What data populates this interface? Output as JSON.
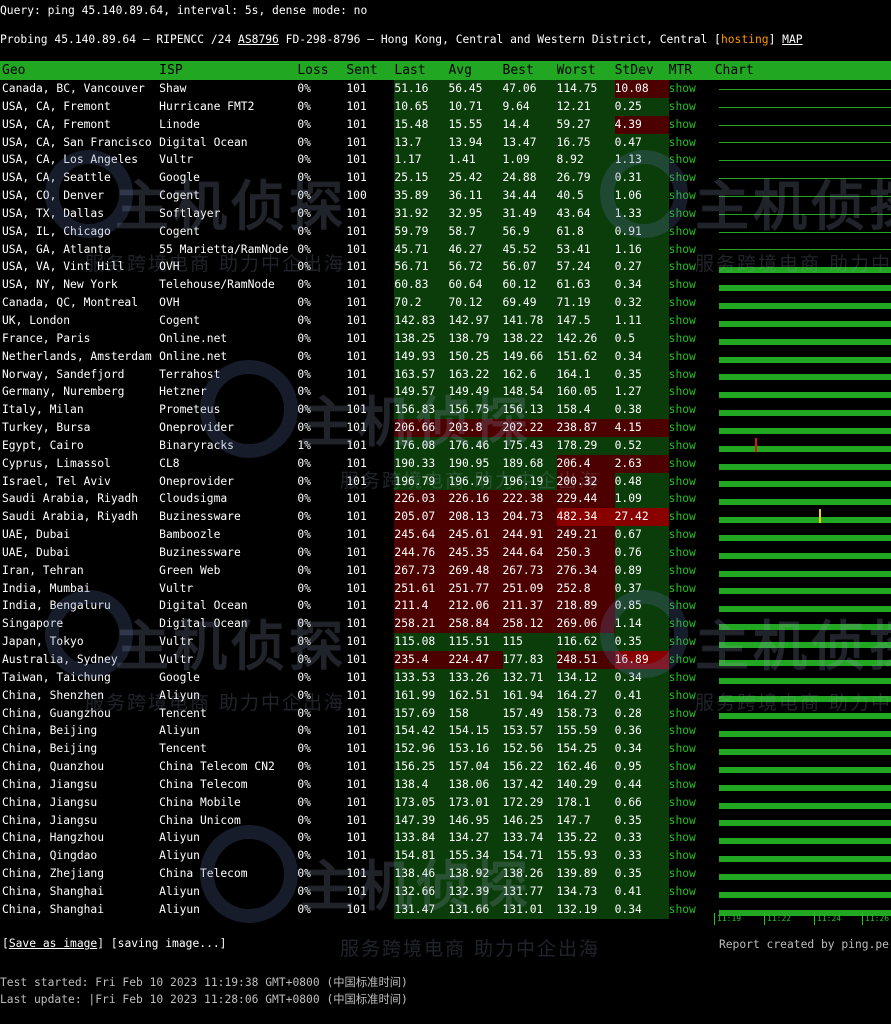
{
  "query_line": "Query: ping 45.140.89.64, interval: 5s, dense mode: no",
  "probe": {
    "prefix": "Probing 45.140.89.64 – RIPENCC /24 ",
    "asn": "AS8796",
    "middle": " FD-298-8796 – Hong Kong, Central and Western District, Central [",
    "tag": "hosting",
    "close": "] ",
    "map": "MAP"
  },
  "headers": [
    "Geo",
    "ISP",
    "Loss",
    "Sent",
    "Last",
    "Avg",
    "Best",
    "Worst",
    "StDev",
    "MTR",
    "Chart"
  ],
  "mtr_label": "show",
  "rows": [
    [
      "Canada, BC, Vancouver",
      "Shaw",
      "0%",
      "101",
      "51.16",
      "56.45",
      "47.06",
      "114.75",
      "10.08"
    ],
    [
      "USA, CA, Fremont",
      "Hurricane FMT2",
      "0%",
      "101",
      "10.65",
      "10.71",
      "9.64",
      "12.21",
      "0.25"
    ],
    [
      "USA, CA, Fremont",
      "Linode",
      "0%",
      "101",
      "15.48",
      "15.55",
      "14.4",
      "59.27",
      "4.39"
    ],
    [
      "USA, CA, San Francisco",
      "Digital Ocean",
      "0%",
      "101",
      "13.7",
      "13.94",
      "13.47",
      "16.75",
      "0.47"
    ],
    [
      "USA, CA, Los Angeles",
      "Vultr",
      "0%",
      "101",
      "1.17",
      "1.41",
      "1.09",
      "8.92",
      "1.13"
    ],
    [
      "USA, CA, Seattle",
      "Google",
      "0%",
      "101",
      "25.15",
      "25.42",
      "24.88",
      "26.79",
      "0.31"
    ],
    [
      "USA, CO, Denver",
      "Cogent",
      "0%",
      "100",
      "35.89",
      "36.11",
      "34.44",
      "40.5",
      "1.06"
    ],
    [
      "USA, TX, Dallas",
      "Softlayer",
      "0%",
      "101",
      "31.92",
      "32.95",
      "31.49",
      "43.64",
      "1.33"
    ],
    [
      "USA, IL, Chicago",
      "Cogent",
      "0%",
      "101",
      "59.79",
      "58.7",
      "56.9",
      "61.8",
      "0.91"
    ],
    [
      "USA, GA, Atlanta",
      "55 Marietta/RamNode",
      "0%",
      "101",
      "45.71",
      "46.27",
      "45.52",
      "53.41",
      "1.16"
    ],
    [
      "USA, VA, Vint Hill",
      "OVH",
      "0%",
      "101",
      "56.71",
      "56.72",
      "56.07",
      "57.24",
      "0.27"
    ],
    [
      "USA, NY, New York",
      "Telehouse/RamNode",
      "0%",
      "101",
      "60.83",
      "60.64",
      "60.12",
      "61.63",
      "0.34"
    ],
    [
      "Canada, QC, Montreal",
      "OVH",
      "0%",
      "101",
      "70.2",
      "70.12",
      "69.49",
      "71.19",
      "0.32"
    ],
    [
      "UK, London",
      "Cogent",
      "0%",
      "101",
      "142.83",
      "142.97",
      "141.78",
      "147.5",
      "1.11"
    ],
    [
      "France, Paris",
      "Online.net",
      "0%",
      "101",
      "138.25",
      "138.79",
      "138.22",
      "142.26",
      "0.5"
    ],
    [
      "Netherlands, Amsterdam",
      "Online.net",
      "0%",
      "101",
      "149.93",
      "150.25",
      "149.66",
      "151.62",
      "0.34"
    ],
    [
      "Norway, Sandefjord",
      "Terrahost",
      "0%",
      "101",
      "163.57",
      "163.22",
      "162.6",
      "164.1",
      "0.35"
    ],
    [
      "Germany, Nuremberg",
      "Hetzner",
      "0%",
      "101",
      "149.57",
      "149.49",
      "148.54",
      "160.05",
      "1.27"
    ],
    [
      "Italy, Milan",
      "Prometeus",
      "0%",
      "101",
      "156.83",
      "156.75",
      "156.13",
      "158.4",
      "0.38"
    ],
    [
      "Turkey, Bursa",
      "Oneprovider",
      "0%",
      "101",
      "206.66",
      "203.8",
      "202.22",
      "238.87",
      "4.15"
    ],
    [
      "Egypt, Cairo",
      "Binaryracks",
      "1%",
      "101",
      "176.08",
      "176.46",
      "175.43",
      "178.29",
      "0.52"
    ],
    [
      "Cyprus, Limassol",
      "CL8",
      "0%",
      "101",
      "190.33",
      "190.95",
      "189.68",
      "206.4",
      "2.63"
    ],
    [
      "Israel, Tel Aviv",
      "Oneprovider",
      "0%",
      "101",
      "196.79",
      "196.79",
      "196.19",
      "200.32",
      "0.48"
    ],
    [
      "Saudi Arabia, Riyadh",
      "Cloudsigma",
      "0%",
      "101",
      "226.03",
      "226.16",
      "222.38",
      "229.44",
      "1.09"
    ],
    [
      "Saudi Arabia, Riyadh",
      "Buzinessware",
      "0%",
      "101",
      "205.07",
      "208.13",
      "204.73",
      "482.34",
      "27.42"
    ],
    [
      "UAE, Dubai",
      "Bamboozle",
      "0%",
      "101",
      "245.64",
      "245.61",
      "244.91",
      "249.21",
      "0.67"
    ],
    [
      "UAE, Dubai",
      "Buzinessware",
      "0%",
      "101",
      "244.76",
      "245.35",
      "244.64",
      "250.3",
      "0.76"
    ],
    [
      "Iran, Tehran",
      "Green Web",
      "0%",
      "101",
      "267.73",
      "269.48",
      "267.73",
      "276.34",
      "0.89"
    ],
    [
      "India, Mumbai",
      "Vultr",
      "0%",
      "101",
      "251.61",
      "251.77",
      "251.09",
      "252.8",
      "0.37"
    ],
    [
      "India, Bengaluru",
      "Digital Ocean",
      "0%",
      "101",
      "211.4",
      "212.06",
      "211.37",
      "218.89",
      "0.85"
    ],
    [
      "Singapore",
      "Digital Ocean",
      "0%",
      "101",
      "258.21",
      "258.84",
      "258.12",
      "269.06",
      "1.14"
    ],
    [
      "Japan, Tokyo",
      "Vultr",
      "0%",
      "101",
      "115.08",
      "115.51",
      "115",
      "116.62",
      "0.35"
    ],
    [
      "Australia, Sydney",
      "Vultr",
      "0%",
      "101",
      "235.4",
      "224.47",
      "177.83",
      "248.51",
      "16.89"
    ],
    [
      "Taiwan, Taichung",
      "Google",
      "0%",
      "101",
      "133.53",
      "133.26",
      "132.71",
      "134.12",
      "0.34"
    ],
    [
      "China, Shenzhen",
      "Aliyun",
      "0%",
      "101",
      "161.99",
      "162.51",
      "161.94",
      "164.27",
      "0.41"
    ],
    [
      "China, Guangzhou",
      "Tencent",
      "0%",
      "101",
      "157.69",
      "158",
      "157.49",
      "158.73",
      "0.28"
    ],
    [
      "China, Beijing",
      "Aliyun",
      "0%",
      "101",
      "154.42",
      "154.15",
      "153.57",
      "155.59",
      "0.36"
    ],
    [
      "China, Beijing",
      "Tencent",
      "0%",
      "101",
      "152.96",
      "153.16",
      "152.56",
      "154.25",
      "0.34"
    ],
    [
      "China, Quanzhou",
      "China Telecom CN2",
      "0%",
      "101",
      "156.25",
      "157.04",
      "156.22",
      "162.46",
      "0.95"
    ],
    [
      "China, Jiangsu",
      "China Telecom",
      "0%",
      "101",
      "138.4",
      "138.06",
      "137.42",
      "140.29",
      "0.44"
    ],
    [
      "China, Jiangsu",
      "China Mobile",
      "0%",
      "101",
      "173.05",
      "173.01",
      "172.29",
      "178.1",
      "0.66"
    ],
    [
      "China, Jiangsu",
      "China Unicom",
      "0%",
      "101",
      "147.39",
      "146.95",
      "146.25",
      "147.7",
      "0.35"
    ],
    [
      "China, Hangzhou",
      "Aliyun",
      "0%",
      "101",
      "133.84",
      "134.27",
      "133.74",
      "135.22",
      "0.33"
    ],
    [
      "China, Qingdao",
      "Aliyun",
      "0%",
      "101",
      "154.81",
      "155.34",
      "154.71",
      "155.93",
      "0.33"
    ],
    [
      "China, Zhejiang",
      "China Telecom",
      "0%",
      "101",
      "138.46",
      "138.92",
      "138.26",
      "139.89",
      "0.35"
    ],
    [
      "China, Shanghai",
      "Aliyun",
      "0%",
      "101",
      "132.66",
      "132.39",
      "131.77",
      "134.73",
      "0.41"
    ],
    [
      "China, Shanghai",
      "Aliyun",
      "0%",
      "101",
      "131.47",
      "131.66",
      "131.01",
      "132.19",
      "0.34"
    ]
  ],
  "chart_axis": [
    "11:19",
    "11:22",
    "11:24",
    "11:26"
  ],
  "save_link": "Save as image",
  "saving_text": " [saving image...]",
  "report_text": "Report created by ping.pe",
  "test_started": "Test started: Fri Feb 10 2023 11:19:38 GMT+0800 (中国标准时间)",
  "last_update": "Last update: |Fri Feb 10 2023 11:28:06 GMT+0800 (中国标准时间)",
  "watermark": {
    "logo_text": "主机侦探",
    "slogan": "服务跨境电商 助力中企出海"
  },
  "colors": {
    "header_green": "#22a722",
    "cell_green": "#0b3d0b",
    "cell_red": "#4d0000",
    "cell_bright_red": "#8a0000",
    "hosting_orange": "#ff9800",
    "spike_red": "#d11a1a",
    "spike_yellow": "#e6d21a"
  }
}
